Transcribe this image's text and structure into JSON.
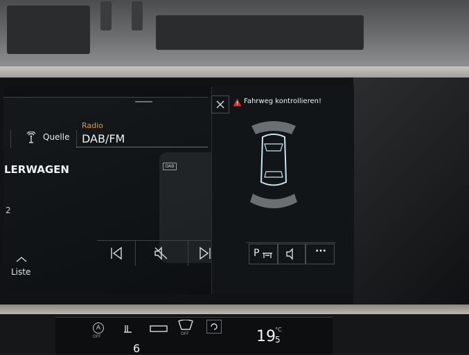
{
  "header": {
    "source_label": "Quelle",
    "radio_label": "Radio",
    "band_label": "DAB/FM"
  },
  "station": {
    "name": "LERWAGEN",
    "number": "2"
  },
  "controls": {
    "list_label": "Liste"
  },
  "park": {
    "warning": "Fahrweg kontrollieren!",
    "p_button_label": "P",
    "more_label": "···"
  },
  "dab_badge": "DAB",
  "climate": {
    "temp_whole": "19",
    "temp_decimal": "5",
    "temp_unit": "°C",
    "fan_level": "6",
    "off_label_1": "OFF",
    "off_label_2": "OFF",
    "auto_label": "A"
  },
  "colors": {
    "accent_radio": "#e49a2a",
    "warning_red": "#d7322d",
    "sensor_grey": "#6a6f73"
  }
}
